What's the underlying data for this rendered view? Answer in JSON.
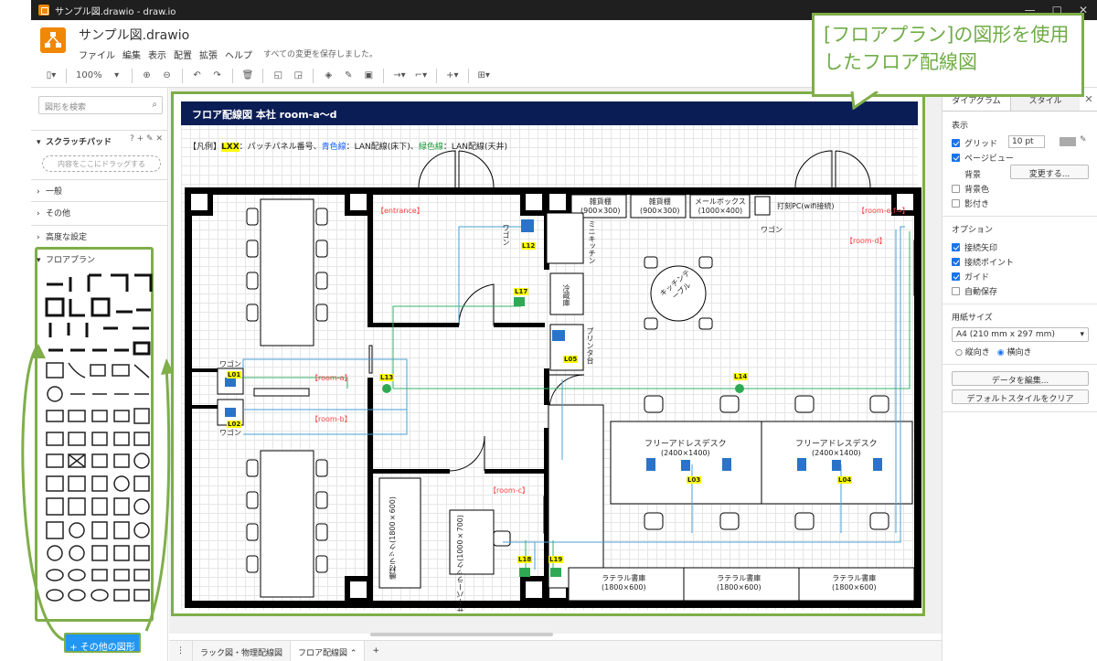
{
  "window": {
    "title": "サンプル図.drawio - draw.io",
    "controls": [
      "—",
      "□",
      "✕"
    ]
  },
  "app": {
    "doc_title": "サンプル図.drawio",
    "menus": [
      "ファイル",
      "編集",
      "表示",
      "配置",
      "拡張",
      "ヘルプ"
    ],
    "saved_status": "すべての変更を保存しました。"
  },
  "toolbar": {
    "zoom": "100%"
  },
  "left_panel": {
    "search_placeholder": "図形を検索",
    "scratchpad": "スクラッチパッド",
    "drag_here": "内容をここにドラッグする",
    "sections": [
      "一般",
      "その他",
      "高度な設定",
      "フロアプラン"
    ],
    "more_shapes": "+ その他の図形"
  },
  "callout": {
    "text": "[フロアプラン]の図形を使用したフロア配線図"
  },
  "plan": {
    "header": "フロア配線図 本社 room-a〜d",
    "legend": {
      "prefix": "【凡例】",
      "lxx": "LXX",
      "lxx_desc": "：パッチパネル番号、",
      "blue": "青色線",
      "blue_desc": "：LAN配線(床下)、",
      "green": "緑色線",
      "green_desc": "：LAN配線(天井)"
    },
    "rooms": {
      "entrance": "【entrance】",
      "room_a": "【room-a】",
      "room_b": "【room-b】",
      "room_c": "【room-c】",
      "room_d": "【room-d】",
      "room_ef": "【room-e,f⇒】"
    },
    "furniture": {
      "shelf1": "雑貨棚",
      "shelf1_size": "(900×300)",
      "shelf2": "雑貨棚",
      "shelf2_size": "(900×300)",
      "mailbox": "メールボックス",
      "mailbox_size": "(1000×400)",
      "timecard": "打刻PC(wifi接続)",
      "wagon1": "ワゴン",
      "wagon2": "ワゴン",
      "wagon3": "ワゴン",
      "wagon4": "ワゴン",
      "minikitchen": "ミニキッチン",
      "fridge": "冷蔵庫",
      "printer": "プリンタ台",
      "kitchen_table": "キッチンテーブル",
      "free_desk1": "フリーアドレスデスク",
      "free_desk1_size": "(2400×1400)",
      "free_desk2": "フリーアドレスデスク",
      "free_desk2_size": "(2400×1400)",
      "equip_rack": "機材ラック",
      "equip_rack_size": "(1800×600)",
      "server_rack": "サーバーラック",
      "server_rack_size": "(1000×700)",
      "lateral1": "ラテラル書庫",
      "lateral1_size": "(1800×600)",
      "lateral2": "ラテラル書庫",
      "lateral2_size": "(1800×600)",
      "lateral3": "ラテラル書庫",
      "lateral3_size": "(1800×600)"
    },
    "ports": [
      "L01",
      "L02",
      "L03",
      "L04",
      "L05",
      "L12",
      "L13",
      "L14",
      "L17",
      "L18",
      "L19"
    ]
  },
  "right_panel": {
    "tabs": [
      "ダイアグラム",
      "スタイル"
    ],
    "view_label": "表示",
    "grid": "グリッド",
    "grid_size": "10 pt",
    "page_view": "ページビュー",
    "background": "背景",
    "change_btn": "変更する...",
    "bg_color": "背景色",
    "shadow": "影付き",
    "options_label": "オプション",
    "opts": [
      "接続矢印",
      "接続ポイント",
      "ガイド",
      "自動保存"
    ],
    "paper_label": "用紙サイズ",
    "paper": "A4 (210 mm x 297 mm)",
    "portrait": "縦向き",
    "landscape": "横向き",
    "edit_data": "データを編集...",
    "clear_style": "デフォルトスタイルをクリア"
  },
  "bottom_tabs": [
    "ラック図・物理配線図",
    "フロア配線図"
  ],
  "colors": {
    "accent_green": "#70ad47",
    "header_navy": "#0b1d55",
    "blue_line": "#4a9fd5",
    "green_line": "#36b36b",
    "port_yellow": "#ffff00",
    "red_label": "#ff4444"
  }
}
